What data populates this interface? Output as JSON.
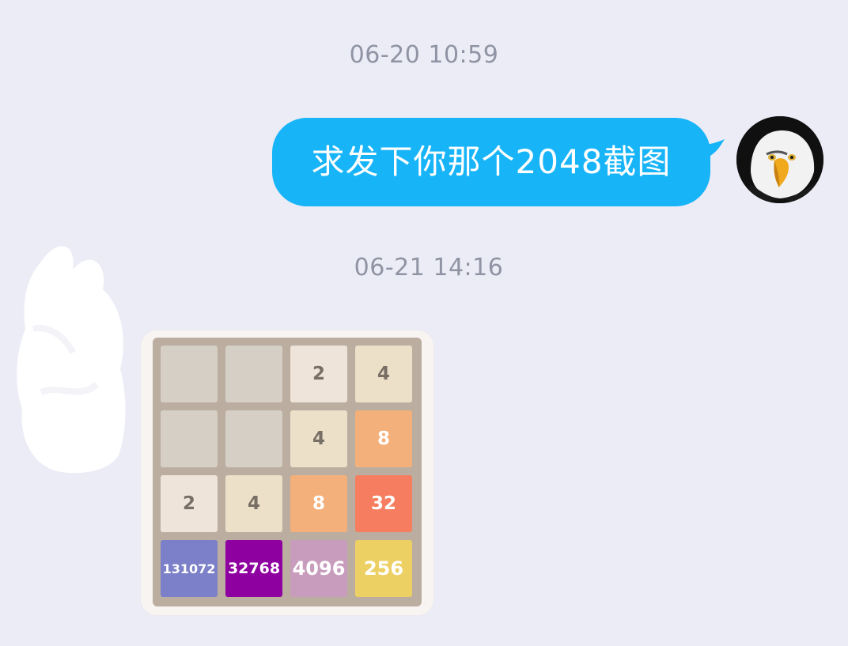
{
  "chat": {
    "timestamps": [
      "06-20 10:59",
      "06-21 14:16"
    ],
    "outgoing_message": "求发下你那个2048截图",
    "sender_avatar_icon": "eagle-avatar-icon",
    "reply_image_description_icon": "game-screenshot-icon"
  },
  "game": {
    "colors": {
      "board": "#bbad9f",
      "empty": "#d6cfc6",
      "bubble": "#18b4f8",
      "background": "#ebecf5"
    },
    "tiles": [
      [
        "",
        "",
        "2",
        "4"
      ],
      [
        "",
        "",
        "4",
        "8"
      ],
      [
        "2",
        "4",
        "8",
        "32"
      ],
      [
        "131072",
        "32768",
        "4096",
        "256"
      ]
    ]
  }
}
